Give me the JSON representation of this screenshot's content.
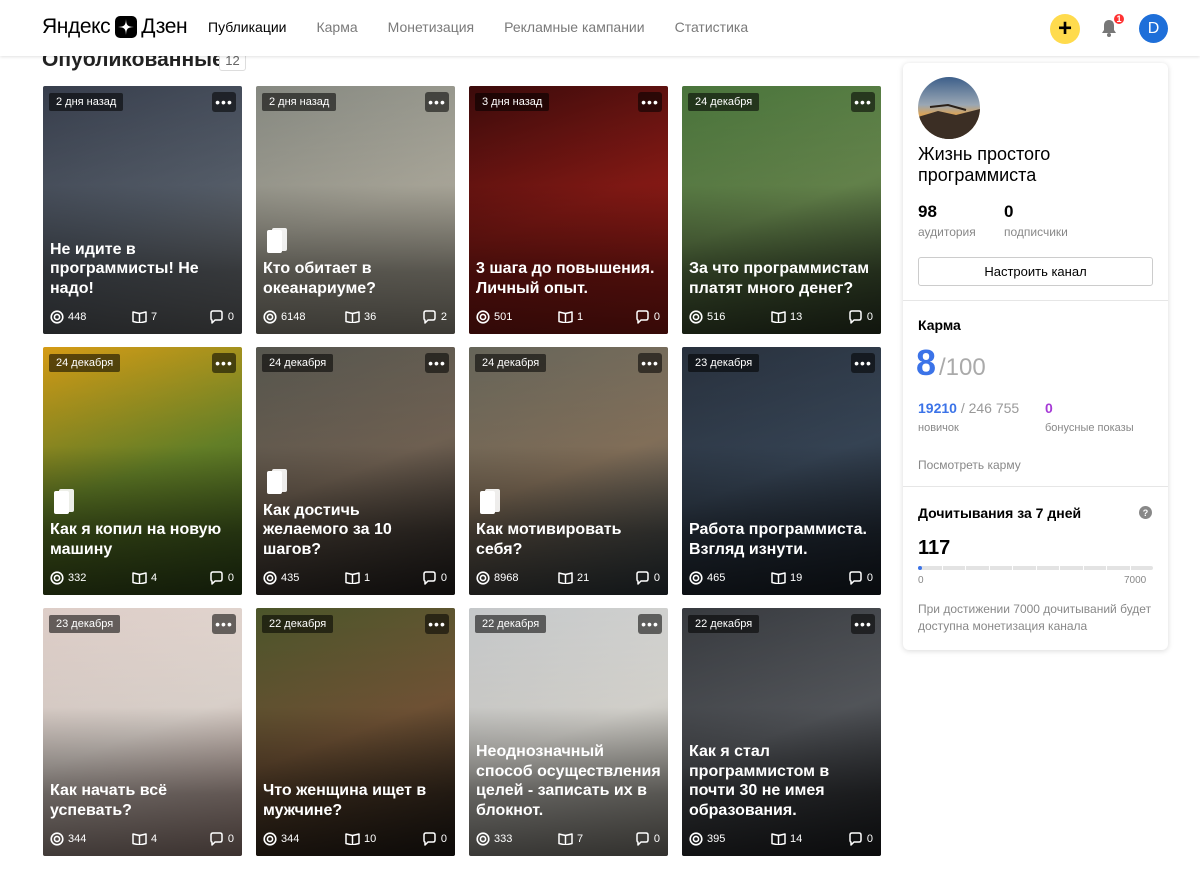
{
  "header": {
    "logo_word1": "Яндекс",
    "logo_word2": "Дзен",
    "nav": [
      {
        "label": "Публикации",
        "active": true
      },
      {
        "label": "Карма",
        "active": false
      },
      {
        "label": "Монетизация",
        "active": false
      },
      {
        "label": "Рекламные кампании",
        "active": false
      },
      {
        "label": "Статистика",
        "active": false
      }
    ],
    "add_label": "+",
    "notifications_count": "1",
    "user_initial": "D"
  },
  "section": {
    "title": "Опубликованные",
    "count": "12"
  },
  "cards": [
    {
      "date": "2 дня назад",
      "title": "Не идите в программисты! Не надо!",
      "views": "448",
      "reads": "7",
      "comments": "0",
      "article_icon": false,
      "bg": [
        "#3a4150",
        "#5b6471",
        "#8a8d8f"
      ]
    },
    {
      "date": "2 дня назад",
      "title": "Кто обитает в океанариуме?",
      "views": "6148",
      "reads": "36",
      "comments": "2",
      "article_icon": true,
      "bg": [
        "#8c8f87",
        "#b7b4a6",
        "#c9c2b0"
      ]
    },
    {
      "date": "3 дня назад",
      "title": "3 шага до повышения. Личный опыт.",
      "views": "501",
      "reads": "1",
      "comments": "0",
      "article_icon": false,
      "bg": [
        "#3e0b0b",
        "#8e1b16",
        "#b8201a"
      ]
    },
    {
      "date": "24 декабря",
      "title": "За что программистам платят много денег?",
      "views": "516",
      "reads": "13",
      "comments": "0",
      "article_icon": false,
      "bg": [
        "#4d7a3e",
        "#6d8f52",
        "#38472e"
      ]
    },
    {
      "date": "24 декабря",
      "title": "Как я копил на новую машину",
      "views": "332",
      "reads": "4",
      "comments": "0",
      "article_icon": true,
      "bg": [
        "#e0a316",
        "#6e8d2b",
        "#3b5a1f"
      ]
    },
    {
      "date": "24 декабря",
      "title": "Как достичь желаемого за 10 шагов?",
      "views": "435",
      "reads": "1",
      "comments": "0",
      "article_icon": true,
      "bg": [
        "#5a5a52",
        "#7a6a5a",
        "#2f2a28"
      ]
    },
    {
      "date": "24 декабря",
      "title": "Как мотивировать себя?",
      "views": "8968",
      "reads": "21",
      "comments": "0",
      "article_icon": true,
      "bg": [
        "#6b6a5e",
        "#8f7a62",
        "#3c4a52"
      ]
    },
    {
      "date": "23 декабря",
      "title": "Работа программиста. Взгляд изнути.",
      "views": "465",
      "reads": "19",
      "comments": "0",
      "article_icon": false,
      "bg": [
        "#2a3340",
        "#3b4a5c",
        "#1d2530"
      ]
    },
    {
      "date": "23 декабря",
      "title": "Как начать всё успевать?",
      "views": "344",
      "reads": "4",
      "comments": "0",
      "article_icon": false,
      "bg": [
        "#e9d8d2",
        "#f0e6df",
        "#c9a9a0"
      ]
    },
    {
      "date": "22 декабря",
      "title": "Что женщина ищет в мужчине?",
      "views": "344",
      "reads": "10",
      "comments": "0",
      "article_icon": false,
      "bg": [
        "#4f5a2c",
        "#7a5a3a",
        "#2b221c"
      ]
    },
    {
      "date": "22 декабря",
      "title": "Неоднозначный способ осуществления целей - записать их в блокнот.",
      "views": "333",
      "reads": "7",
      "comments": "0",
      "article_icon": false,
      "bg": [
        "#cfd2d4",
        "#e8e6e0",
        "#a8a49a"
      ]
    },
    {
      "date": "22 декабря",
      "title": "Как я стал программистом в почти 30 не имея образования.",
      "views": "395",
      "reads": "14",
      "comments": "0",
      "article_icon": false,
      "bg": [
        "#3a3d42",
        "#5a5d62",
        "#25272b"
      ]
    }
  ],
  "sidebar": {
    "channel_name": "Жизнь простого программиста",
    "audience_value": "98",
    "audience_label": "аудитория",
    "subscribers_value": "0",
    "subscribers_label": "подписчики",
    "configure_label": "Настроить канал",
    "karma_title": "Карма",
    "karma_value": "8",
    "karma_max": "/100",
    "karma_current": "19210",
    "karma_total": " / 246 755",
    "karma_level": "новичок",
    "bonus_value": "0",
    "bonus_label": "бонусные показы",
    "karma_link": "Посмотреть карму",
    "reads_title": "Дочитывания за 7 дней",
    "reads_help": "?",
    "reads_value": "117",
    "reads_fraction": 0.0167,
    "reads_min": "0",
    "reads_max": "7000",
    "reads_note": "При достижении 7000 дочитываний будет доступна монетизация канала"
  },
  "colors": {
    "accent": "#3b73e8",
    "bonus": "#a63ad6",
    "add_button": "#ffdb4d",
    "avatar": "#1e6fd9"
  }
}
